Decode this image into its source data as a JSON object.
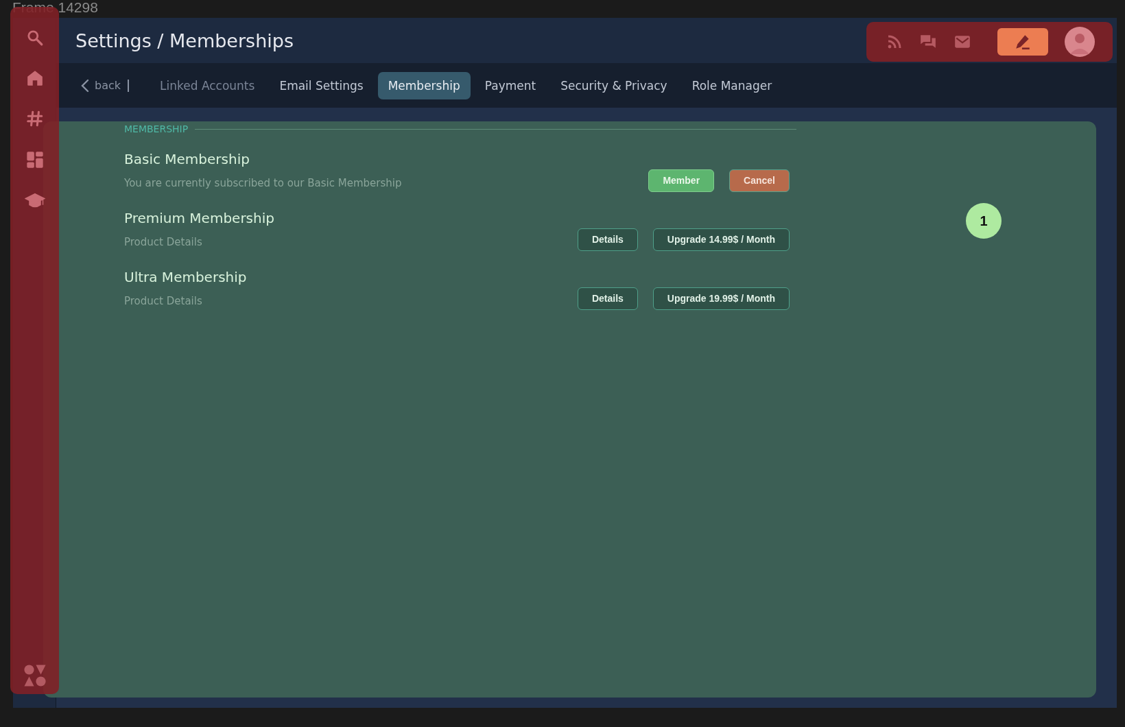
{
  "frame_label": "Frame 14298",
  "header": {
    "title": "Settings / Memberships"
  },
  "nav": {
    "back": "back",
    "tabs": [
      {
        "label": "Linked Accounts",
        "selected": false,
        "disabled": true
      },
      {
        "label": "Email Settings",
        "selected": false,
        "disabled": false
      },
      {
        "label": "Membership",
        "selected": true,
        "disabled": false
      },
      {
        "label": "Payment",
        "selected": false,
        "disabled": false
      },
      {
        "label": "Security & Privacy",
        "selected": false,
        "disabled": false
      },
      {
        "label": "Role Manager",
        "selected": false,
        "disabled": false
      }
    ]
  },
  "section": {
    "label": "MEMBERSHIP",
    "memberships": [
      {
        "title": "Basic Membership",
        "description": "You are currently subscribed to our Basic Membership",
        "buttons": [
          {
            "label": "Member",
            "kind": "member"
          },
          {
            "label": "Cancel",
            "kind": "cancel"
          }
        ]
      },
      {
        "title": "Premium Membership",
        "description": "Product Details",
        "buttons": [
          {
            "label": "Details",
            "kind": "outline"
          },
          {
            "label": "Upgrade 14.99$ / Month",
            "kind": "outline"
          }
        ]
      },
      {
        "title": "Ultra Membership",
        "description": "Product Details",
        "buttons": [
          {
            "label": "Details",
            "kind": "outline"
          },
          {
            "label": "Upgrade 19.99$ / Month",
            "kind": "outline"
          }
        ]
      }
    ]
  },
  "annotation": {
    "number": "1"
  }
}
